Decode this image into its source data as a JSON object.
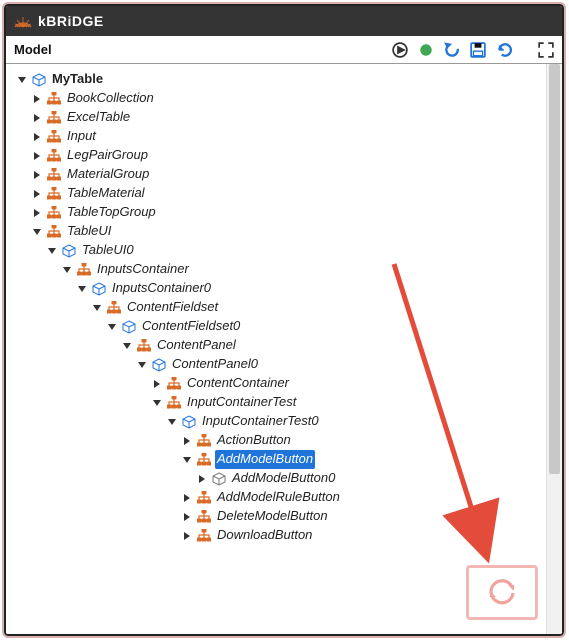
{
  "app": {
    "brand_k": "k",
    "brand_bridge": "BRiDGE",
    "panel_title": "Model"
  },
  "colors": {
    "orange": "#d96b27",
    "blue": "#1e74d8",
    "cube_blue": "#1e74d8",
    "cube_gray": "#777",
    "green_dot": "#3fa653",
    "red": "#e34c3a",
    "arrow": "#e34c3a",
    "pink_border": "#f3b7b3",
    "pink_icon": "#f0a39d"
  },
  "icons": {
    "play": "play-icon",
    "dot": "status-dot-icon",
    "undo": "undo-icon",
    "save": "save-icon",
    "refresh": "refresh-icon",
    "expand": "expand-icon"
  },
  "tree": {
    "root": {
      "label": "MyTable",
      "expanded": true,
      "bold": true
    },
    "level1": [
      {
        "label": "BookCollection",
        "expanded": false
      },
      {
        "label": "ExcelTable",
        "expanded": false
      },
      {
        "label": "Input",
        "expanded": false
      },
      {
        "label": "LegPairGroup",
        "expanded": false
      },
      {
        "label": "MaterialGroup",
        "expanded": false
      },
      {
        "label": "TableMaterial",
        "expanded": false
      },
      {
        "label": "TableTopGroup",
        "expanded": false
      },
      {
        "label": "TableUI",
        "expanded": true
      }
    ],
    "tableui0": "TableUI0",
    "inputscontainer": "InputsContainer",
    "inputscontainer0": "InputsContainer0",
    "contentfieldset": "ContentFieldset",
    "contentfieldset0": "ContentFieldset0",
    "contentpanel": "ContentPanel",
    "contentpanel0": "ContentPanel0",
    "cp_children": [
      {
        "label": "ContentContainer",
        "expanded": false
      },
      {
        "label": "InputContainerTest",
        "expanded": true
      }
    ],
    "ict0": "InputContainerTest0",
    "ict0_children": [
      {
        "label": "ActionButton",
        "expanded": false
      },
      {
        "label": "AddModelButton",
        "expanded": true,
        "selected": true
      }
    ],
    "addmodelbutton0": "AddModelButton0",
    "ict0_rest": [
      {
        "label": "AddModelRuleButton",
        "expanded": false
      },
      {
        "label": "DeleteModelButton",
        "expanded": false
      },
      {
        "label": "DownloadButton",
        "expanded": false
      }
    ]
  }
}
